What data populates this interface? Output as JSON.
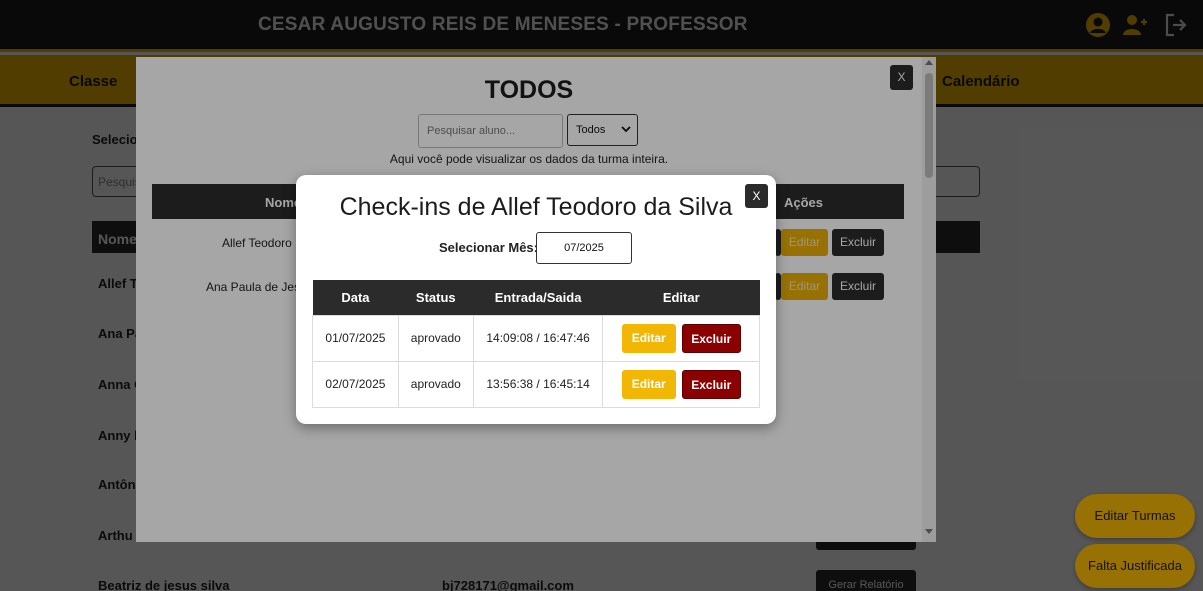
{
  "header": {
    "title": "CESAR AUGUSTO REIS DE MENESES - PROFESSOR",
    "icons": [
      "user-circle-icon",
      "add-user-icon",
      "logout-icon"
    ]
  },
  "nav": {
    "classe": "Classe",
    "calendario": "Calendário"
  },
  "page": {
    "select_label": "Selecio",
    "search_placeholder": "Pesquis",
    "list_header": "Nome",
    "rows": [
      "Allef T",
      "Ana Pa",
      "Anna C",
      "Anny l",
      "Antôn",
      "Arthu",
      "Beatriz de jesus silva"
    ],
    "last_row_email": "bj728171@gmail.com",
    "row_button": "Gerar Relatório"
  },
  "floating": {
    "editar_turmas": "Editar Turmas",
    "falta_justificada": "Falta Justificada"
  },
  "modal_todos": {
    "title": "TODOS",
    "close": "X",
    "search_placeholder": "Pesquisar aluno...",
    "filter_value": "Todos",
    "info": "Aqui você pode visualizar os dados da turma inteira.",
    "col_name": "Nome",
    "col_actions": "Ações",
    "rows": [
      {
        "name": "Allef Teodoro",
        "edit": "Editar",
        "delete": "Excluir"
      },
      {
        "name": "Ana Paula de Jes",
        "edit": "Editar",
        "delete": "Excluir"
      }
    ]
  },
  "modal_checkins": {
    "title": "Check-ins de Allef Teodoro da Silva",
    "close": "X",
    "month_label": "Selecionar Mês:",
    "month_value": "07/2025",
    "columns": [
      "Data",
      "Status",
      "Entrada/Saida",
      "Editar"
    ],
    "rows": [
      {
        "date": "01/07/2025",
        "status": "aprovado",
        "times": "14:09:08 / 16:47:46",
        "edit": "Editar",
        "delete": "Excluir"
      },
      {
        "date": "02/07/2025",
        "status": "aprovado",
        "times": "13:56:38 / 16:45:14",
        "edit": "Editar",
        "delete": "Excluir"
      }
    ]
  },
  "colors": {
    "accent": "#f2b705",
    "dark": "#1c1c1c",
    "delete_red": "#8b0000"
  }
}
